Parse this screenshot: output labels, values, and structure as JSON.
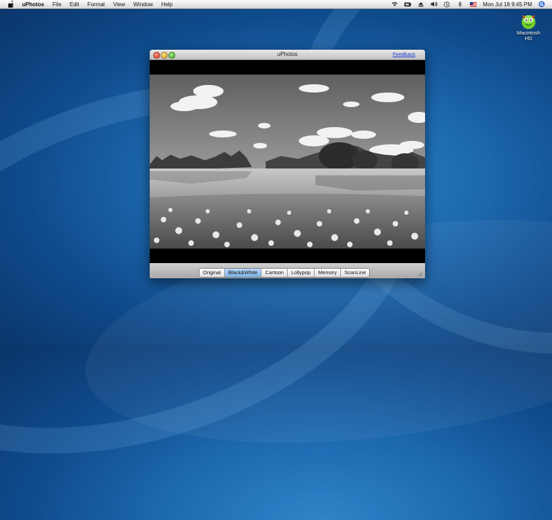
{
  "menubar": {
    "items": [
      {
        "label": "uPhotos"
      },
      {
        "label": "File"
      },
      {
        "label": "Edit"
      },
      {
        "label": "Format"
      },
      {
        "label": "View"
      },
      {
        "label": "Window"
      },
      {
        "label": "Help"
      }
    ],
    "clock": "Mon Jul 18  9:45 PM",
    "status_icons": [
      "wifi-icon",
      "battery-icon",
      "eject-icon",
      "volume-icon",
      "time-machine-icon",
      "bluetooth-icon",
      "flag-icon",
      "spotlight-icon"
    ]
  },
  "desktop": {
    "hd_label_line1": "Macintosh",
    "hd_label_line2": "HD"
  },
  "window": {
    "title": "uPhotos",
    "feedback_label": "Feedback",
    "filters": [
      {
        "label": "Original",
        "selected": false
      },
      {
        "label": "Black&White",
        "selected": true
      },
      {
        "label": "Cartoon",
        "selected": false
      },
      {
        "label": "Lollypop",
        "selected": false
      },
      {
        "label": "Memory",
        "selected": false
      },
      {
        "label": "ScanLine",
        "selected": false
      }
    ]
  },
  "colors": {
    "selected_segment": "#8fbcec",
    "link": "#1a3cd6",
    "wallpaper": "#1d69b0"
  }
}
